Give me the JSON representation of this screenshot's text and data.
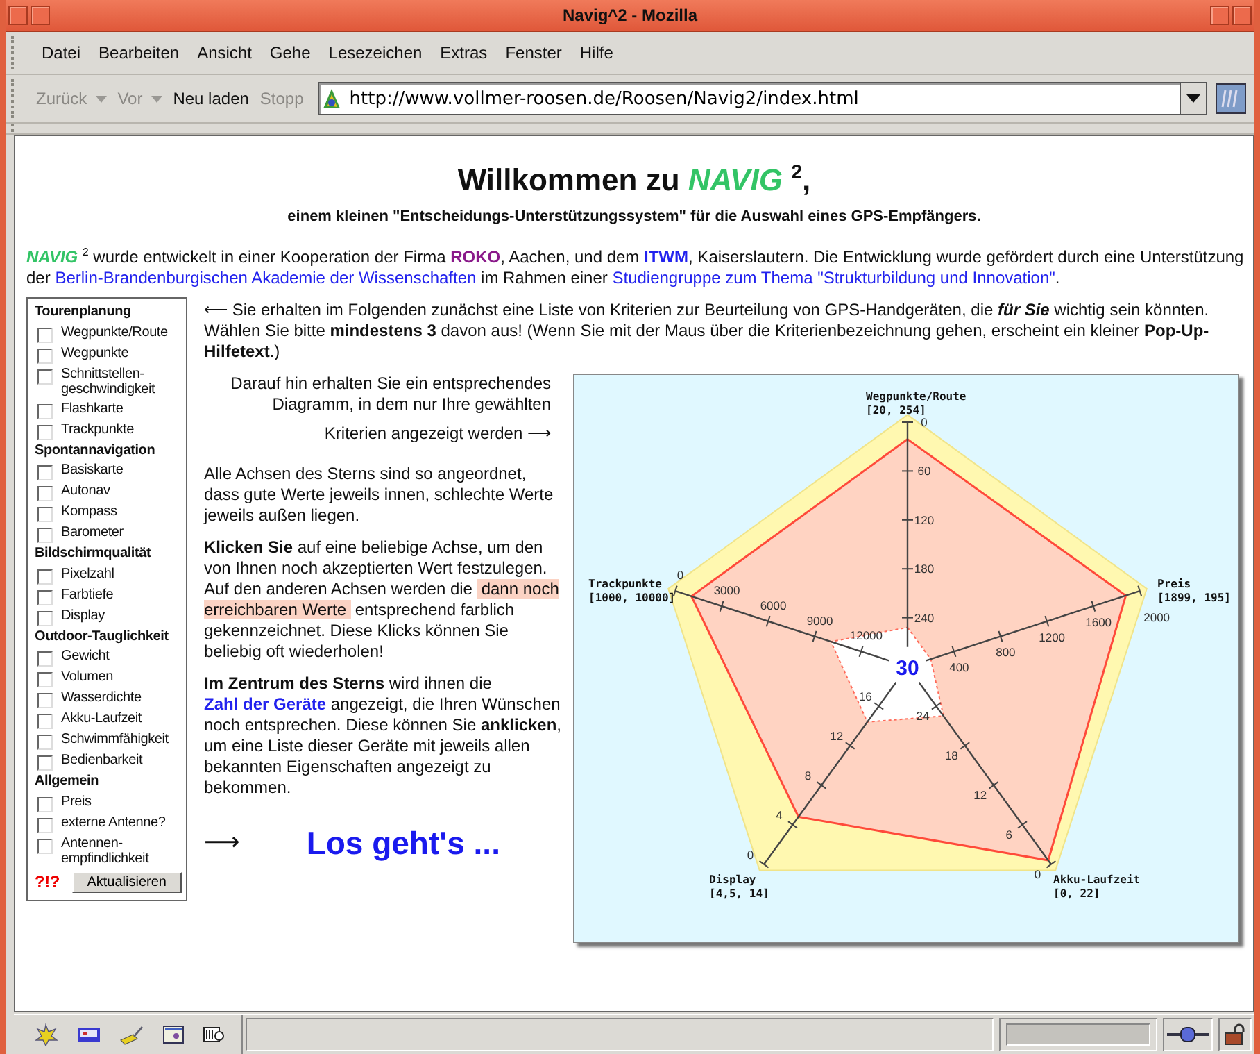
{
  "window": {
    "title": "Navig^2 - Mozilla"
  },
  "menu": [
    "Datei",
    "Bearbeiten",
    "Ansicht",
    "Gehe",
    "Lesezeichen",
    "Extras",
    "Fenster",
    "Hilfe"
  ],
  "toolbar": {
    "buttons": [
      {
        "label": "Zurück",
        "dropdown": true,
        "disabled": true
      },
      {
        "label": "Vor",
        "dropdown": true,
        "disabled": true
      },
      {
        "label": "Neu laden",
        "dropdown": false,
        "disabled": false
      },
      {
        "label": "Stopp",
        "dropdown": false,
        "disabled": true
      }
    ],
    "url": "http://www.vollmer-roosen.de/Roosen/Navig2/index.html"
  },
  "page": {
    "heading": "Willkommen zu *NAVIG* $^{2}$,",
    "subheading": "einem kleinen \"Entscheidungs-Unterstützungssystem\" für die Auswahl eines GPS-Empfängers.",
    "intro": [
      {
        "kind": "text",
        "text": "*NAVIG* $^{2}$ wurde entwickelt in einer Kooperation der Firma "
      },
      {
        "kind": "link",
        "text": "ROKO",
        "bold": true,
        "visited": true
      },
      {
        "kind": "text",
        "text": ", Aachen, und dem "
      },
      {
        "kind": "link",
        "text": "ITWM",
        "bold": true,
        "visited": false
      },
      {
        "kind": "text",
        "text": ", Kaiserslautern. Die Entwicklung wurde gefördert durch eine Unterstützung der "
      },
      {
        "kind": "link",
        "text": "Berlin-Brandenburgischen Akademie der Wissenschaften",
        "bold": false,
        "visited": false
      },
      {
        "kind": "text",
        "text": " im Rahmen einer "
      },
      {
        "kind": "link",
        "text": "Studiengruppe zum Thema \"Strukturbildung und Innovation\"",
        "bold": false,
        "visited": false
      },
      {
        "kind": "text",
        "text": "."
      }
    ],
    "sidebar": {
      "groups": [
        {
          "title": "Tourenplanung",
          "items": [
            {
              "label": "Wegpunkte/Route",
              "checked": false
            },
            {
              "label": "Wegpunkte",
              "checked": false
            },
            {
              "label": "Schnittstellen-geschwindigkeit",
              "checked": false
            },
            {
              "label": "Flashkarte",
              "checked": false
            },
            {
              "label": "Trackpunkte",
              "checked": false
            }
          ]
        },
        {
          "title": "Spontannavigation",
          "items": [
            {
              "label": "Basiskarte",
              "checked": false
            },
            {
              "label": "Autonav",
              "checked": false
            },
            {
              "label": "Kompass",
              "checked": false
            },
            {
              "label": "Barometer",
              "checked": false
            }
          ]
        },
        {
          "title": "Bildschirmqualität",
          "items": [
            {
              "label": "Pixelzahl",
              "checked": false
            },
            {
              "label": "Farbtiefe",
              "checked": false
            },
            {
              "label": "Display",
              "checked": false
            }
          ]
        },
        {
          "title": "Outdoor-Tauglichkeit",
          "items": [
            {
              "label": "Gewicht",
              "checked": false
            },
            {
              "label": "Volumen",
              "checked": false
            },
            {
              "label": "Wasserdichte",
              "checked": false
            },
            {
              "label": "Akku-Laufzeit",
              "checked": false
            },
            {
              "label": "Schwimmfähigkeit",
              "checked": false
            },
            {
              "label": "Bedienbarkeit",
              "checked": false
            }
          ]
        },
        {
          "title": "Allgemein",
          "items": [
            {
              "label": "Preis",
              "checked": false
            },
            {
              "label": "externe Antenne?",
              "checked": false
            },
            {
              "label": "Antennen-empfindlichkeit",
              "checked": false
            }
          ]
        }
      ],
      "help": "?!?",
      "button": "Aktualisieren"
    },
    "instructions": "⟵ Sie erhalten im Folgenden zunächst eine Liste von Kriterien zur Beurteilung von GPS-Handgeräten, die *für Sie* wichtig sein könnten. Wählen Sie bitte **mindestens 3** davon aus! (Wenn Sie mit der Maus über die Kriterienbezeichnung gehen, erscheint ein kleiner **Pop-Up-Hilfetext**.)",
    "diagram_note": "Darauf hin erhalten Sie ein entsprechendes Diagramm, in dem nur Ihre gewählten",
    "diagram_note_end": "Kriterien angezeigt werden ⟶",
    "axes_note": "Alle Achsen des Sterns sind so angeordnet, dass gute Werte jeweils innen, schlechte Werte jeweils außen liegen.",
    "click_note": [
      {
        "kind": "text",
        "text": "**Klicken Sie** auf eine beliebige Achse, um den von Ihnen noch akzeptierten Wert festzulegen. Auf den anderen Achsen werden die "
      },
      {
        "kind": "highlight",
        "text": "dann noch erreichbaren Werte"
      },
      {
        "kind": "text",
        "text": " entsprechend farblich gekennzeichnet. Diese Klicks können Sie beliebig oft wiederholen!"
      }
    ],
    "center_note": [
      {
        "kind": "text",
        "text": "**Im Zentrum des Sterns** wird ihnen die "
      },
      {
        "kind": "link",
        "text": "Zahl der Geräte",
        "bold": true,
        "visited": false
      },
      {
        "kind": "text",
        "text": " angezeigt, die Ihren Wünschen noch entsprechen. Diese können Sie **anklicken**, um eine Liste dieser Geräte mit jeweils allen bekannten Eigenschaften angezeigt zu bekommen."
      }
    ],
    "start_arrow": "⟶",
    "start_link": "Los geht's ...",
    "diagram": {
      "count": "30",
      "axes": [
        {
          "name": "Wegpunkte/Route",
          "range": "[20, 254]",
          "ticks": [
            "0",
            "60",
            "120",
            "180",
            "240"
          ]
        },
        {
          "name": "Trackpunkte",
          "range": "[1000, 10000]",
          "ticks": [
            "0",
            "3000",
            "6000",
            "9000",
            "12000"
          ]
        },
        {
          "name": "Preis",
          "range": "[1899, 195]",
          "ticks": [
            "2000",
            "1600",
            "1200",
            "800",
            "400"
          ]
        },
        {
          "name": "Display",
          "range": "[4,5, 14]",
          "ticks": [
            "0",
            "4",
            "8",
            "12",
            "16"
          ]
        },
        {
          "name": "Akku-Laufzeit",
          "range": "[0, 22]",
          "ticks": [
            "0",
            "6",
            "12",
            "18",
            "24"
          ]
        }
      ]
    }
  }
}
